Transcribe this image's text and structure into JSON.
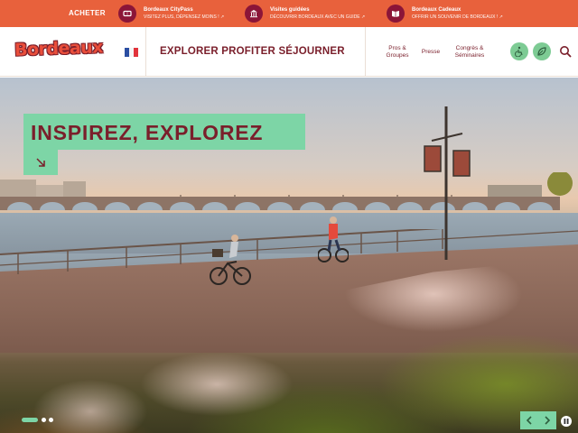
{
  "topbar": {
    "acheter": "ACHETER",
    "promos": [
      {
        "title": "Bordeaux CityPass",
        "subtitle": "VISITEZ PLUS, DÉPENSEZ MOINS !",
        "icon": "ticket-icon"
      },
      {
        "title": "Visites guidées",
        "subtitle": "DÉCOUVRIR BORDEAUX AVEC UN GUIDE",
        "icon": "monument-icon"
      },
      {
        "title": "Bordeaux Cadeaux",
        "subtitle": "OFFRIR UN SOUVENIR DE BORDEAUX !",
        "icon": "book-icon"
      }
    ],
    "colors": {
      "bar": "#e8613c",
      "badge": "#8b1538"
    }
  },
  "header": {
    "logo": "Bordeaux",
    "language": "FR",
    "nav": [
      "EXPLORER",
      "PROFITER",
      "SÉJOURNER"
    ],
    "subnav": {
      "pros_line1": "Pros &",
      "pros_line2": "Groupes",
      "presse": "Presse",
      "congres_line1": "Congrès &",
      "congres_line2": "Séminaires"
    },
    "icons": [
      "accessibility-icon",
      "leaf-icon",
      "search-icon"
    ],
    "colors": {
      "brand": "#7a1f2b",
      "logo": "#e94e3b",
      "accent": "#7dcb94"
    }
  },
  "hero": {
    "headline": "INSPIREZ, EXPLOREZ",
    "cta_icon": "arrow-down-right-icon",
    "slides_total": 3,
    "slide_active": 1,
    "colors": {
      "panel": "#7dd5a6",
      "text": "#7a1f2b"
    }
  }
}
